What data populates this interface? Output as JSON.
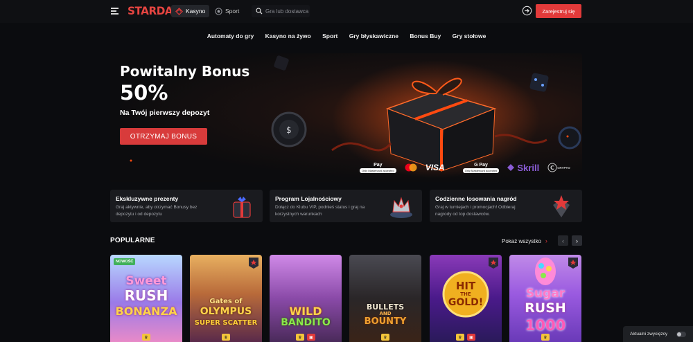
{
  "header": {
    "logo": "STARDA",
    "nav": [
      {
        "label": "Kasyno",
        "active": true,
        "icon": "casino-icon"
      },
      {
        "label": "Sport",
        "active": false,
        "icon": "soccer-ball-icon"
      }
    ],
    "search_placeholder": "Gra lub dostawca",
    "register_label": "Zarejestruj się",
    "accent_color": "#e23a3a"
  },
  "categories": [
    "Automaty do gry",
    "Kasyno na żywo",
    "Sport",
    "Gry błyskawiczne",
    "Bonus Buy",
    "Gry stołowe"
  ],
  "hero": {
    "title": "Powitalny Bonus",
    "percent": "50%",
    "subtitle": "Na Twój pierwszy depozyt",
    "button": "OTRZYMAJ BONUS",
    "payments": [
      "Pay",
      "VISA",
      "G Pay",
      "Skrill",
      "CRYPTO"
    ],
    "payment_note": "Only Mastercard accepted"
  },
  "promos": [
    {
      "title": "Ekskluzywne prezenty",
      "desc": "Graj aktywnie, aby otrzymać Bonusy bez depozytu i od depozytu",
      "icon": "gift-icon"
    },
    {
      "title": "Program Lojalnościowy",
      "desc": "Dołącz do Klubu VIP, podnieś status i graj na korzystnych warunkach",
      "icon": "crown-icon"
    },
    {
      "title": "Codzienne losowania nagród",
      "desc": "Graj w turniejach i promocjach! Odbieraj nagrody od top dostawców.",
      "icon": "star-box-icon"
    }
  ],
  "popular": {
    "title": "POPULARNE",
    "show_all": "Pokaż wszystko",
    "games": [
      {
        "title": "Sweet Rush Bonanza",
        "line1": "Sweet",
        "line2": "RUSH",
        "line3": "BONANZA",
        "badge": "NOWOŚĆ"
      },
      {
        "title": "Gates of Olympus Super Scatter",
        "line1": "Gates of",
        "line2": "OLYMPUS",
        "line3": "SUPER SCATTER",
        "badge": ""
      },
      {
        "title": "Wild Bandito",
        "line1": "",
        "line2": "WILD",
        "line3": "BANDITO",
        "badge": ""
      },
      {
        "title": "Bullets and Bounty",
        "line1": "BULLETS",
        "line2": "AND",
        "line3": "BOUNTY",
        "badge": ""
      },
      {
        "title": "Hit the Gold!",
        "line1": "HIT",
        "line2": "THE",
        "line3": "GOLD!",
        "badge": ""
      },
      {
        "title": "Sugar Rush 1000",
        "line1": "Sugar",
        "line2": "RUSH",
        "line3": "1000",
        "badge": ""
      }
    ]
  },
  "winners_label": "Aktualni zwycięzcy"
}
